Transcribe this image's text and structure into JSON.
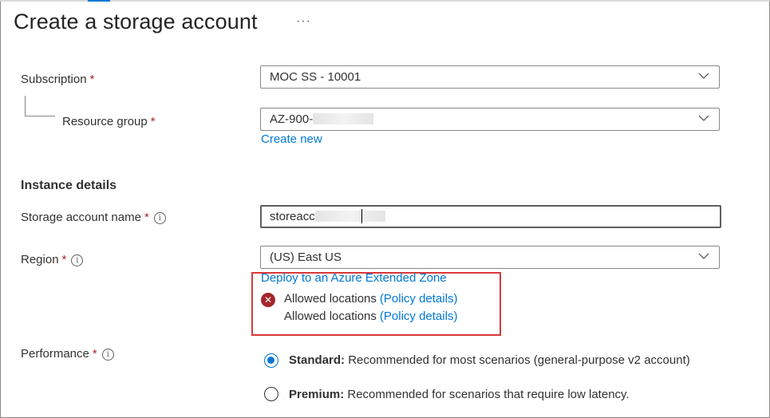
{
  "header": {
    "title": "Create a storage account",
    "more_label": "···"
  },
  "project": {
    "subscription": {
      "label": "Subscription",
      "required": "*",
      "value": "MOC SS - 10001"
    },
    "resource_group": {
      "label": "Resource group",
      "required": "*",
      "value_prefix": "AZ-900-",
      "create_new": "Create new"
    }
  },
  "instance": {
    "heading": "Instance details",
    "storage_name": {
      "label": "Storage account name",
      "required": "*",
      "value_prefix": "storeacc"
    },
    "region": {
      "label": "Region",
      "required": "*",
      "value": "(US) East US",
      "extended_zone_link": "Deploy to an Azure Extended Zone",
      "errors": [
        {
          "text": "Allowed locations",
          "link": "(Policy details)"
        },
        {
          "text": "Allowed locations",
          "link": "(Policy details)"
        }
      ]
    },
    "performance": {
      "label": "Performance",
      "required": "*",
      "options": [
        {
          "title": "Standard:",
          "desc": "Recommended for most scenarios (general-purpose v2 account)",
          "selected": true
        },
        {
          "title": "Premium:",
          "desc": "Recommended for scenarios that require low latency.",
          "selected": false
        }
      ]
    }
  },
  "colors": {
    "accent": "#0078d4",
    "error": "#a4262c",
    "highlight_box": "#d9383a"
  }
}
